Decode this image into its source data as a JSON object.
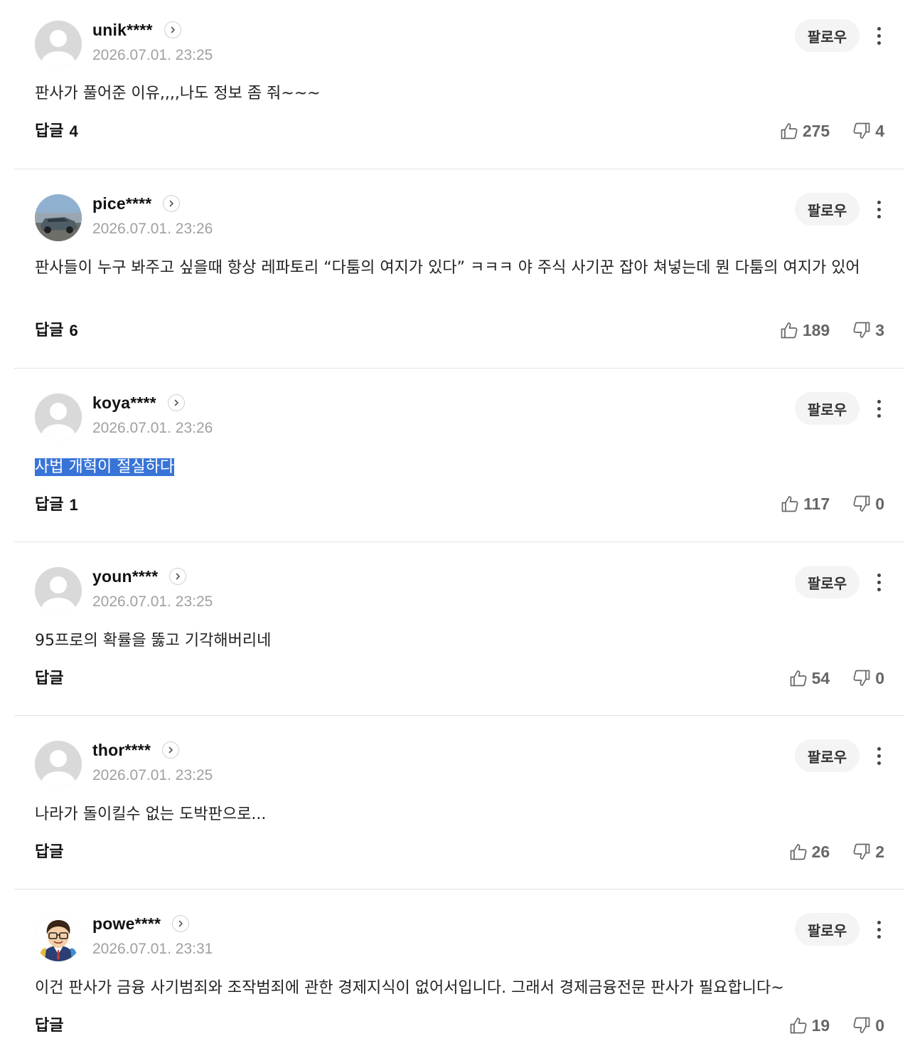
{
  "follow_label": "팔로우",
  "reply_label": "답글",
  "comments": [
    {
      "nickname": "unik****",
      "timestamp": "2026.07.01. 23:25",
      "text": "판사가 풀어준 이유,,,,나도 정보 좀 줘~~~",
      "reply_count": "4",
      "likes": "275",
      "dislikes": "4",
      "avatar": "default-avatar"
    },
    {
      "nickname": "pice****",
      "timestamp": "2026.07.01. 23:26",
      "text": "판사들이 누구 봐주고 싶을때 항상 레파토리 “다툼의 여지가 있다” ㅋㅋㅋ 야 주식 사기꾼 잡아 쳐넣는데 뭔 다툼의 여지가 있어",
      "reply_count": "6",
      "likes": "189",
      "dislikes": "3",
      "avatar": "car-photo-avatar"
    },
    {
      "nickname": "koya****",
      "timestamp": "2026.07.01. 23:26",
      "text": "사법 개혁이 절실하다",
      "text_selected": true,
      "reply_count": "1",
      "likes": "117",
      "dislikes": "0",
      "avatar": "default-avatar"
    },
    {
      "nickname": "youn****",
      "timestamp": "2026.07.01. 23:25",
      "text": "95프로의 확률을 뚫고 기각해버리네",
      "reply_count": "",
      "likes": "54",
      "dislikes": "0",
      "avatar": "default-avatar"
    },
    {
      "nickname": "thor****",
      "timestamp": "2026.07.01. 23:25",
      "text": "나라가 돌이킬수 없는 도박판으로...",
      "reply_count": "",
      "likes": "26",
      "dislikes": "2",
      "avatar": "default-avatar"
    },
    {
      "nickname": "powe****",
      "timestamp": "2026.07.01. 23:31",
      "text": "이건 판사가 금융 사기범죄와 조작범죄에 관한 경제지식이 없어서입니다. 그래서 경제금융전문 판사가 필요합니다~",
      "reply_count": "",
      "likes": "19",
      "dislikes": "0",
      "avatar": "cartoon-person-avatar"
    }
  ],
  "colors": {
    "selection": "#3874d8",
    "timestamp": "#a0a0a0",
    "divider": "#e3e3e3",
    "follow_bg": "#f4f4f4"
  }
}
